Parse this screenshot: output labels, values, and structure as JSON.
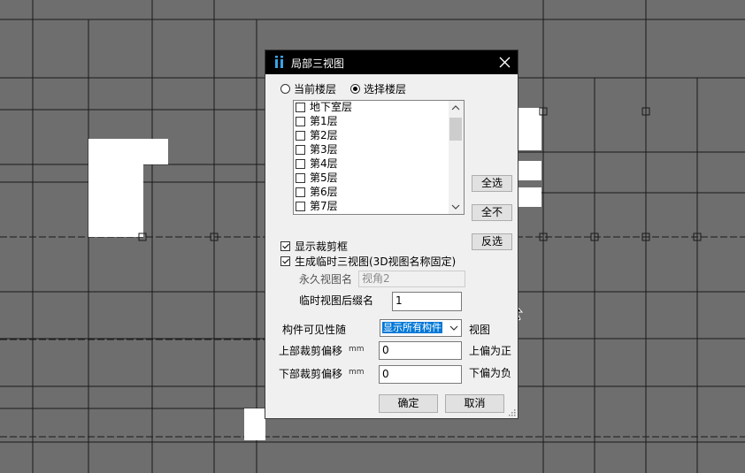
{
  "dialog": {
    "title": "局部三视图",
    "close_icon": "close-icon",
    "floor_mode": {
      "current_label": "当前楼层",
      "select_label": "选择楼层",
      "selected": "select"
    },
    "floors": [
      {
        "label": "地下室层",
        "checked": false
      },
      {
        "label": "第1层",
        "checked": false
      },
      {
        "label": "第2层",
        "checked": false
      },
      {
        "label": "第3层",
        "checked": false
      },
      {
        "label": "第4层",
        "checked": false
      },
      {
        "label": "第5层",
        "checked": false
      },
      {
        "label": "第6层",
        "checked": false
      },
      {
        "label": "第7层",
        "checked": false
      }
    ],
    "buttons": {
      "select_all": "全选",
      "select_none": "全不",
      "invert": "反选",
      "ok": "确定",
      "cancel": "取消"
    },
    "options": {
      "show_crop_frame": {
        "label": "显示裁剪框",
        "checked": true
      },
      "gen_temp_view": {
        "label": "生成临时三视图(3D视图名称固定)",
        "checked": true
      }
    },
    "permanent_view_name": {
      "label": "永久视图名",
      "value": "视角2"
    },
    "temp_view_suffix": {
      "label": "临时视图后缀名",
      "value": "1"
    },
    "visibility": {
      "label": "构件可见性随",
      "selected": "显示所有构件",
      "suffix": "视图"
    },
    "top_offset": {
      "label": "上部裁剪偏移",
      "unit": "mm",
      "value": "0",
      "note": "上偏为正"
    },
    "bottom_offset": {
      "label": "下部裁剪偏移",
      "unit": "mm",
      "value": "0",
      "note": "下偏为负"
    }
  },
  "colors": {
    "titlebar": "#000000",
    "dialog_bg": "#f0f0f0",
    "canvas_bg": "#6e6e6e",
    "selection": "#0078d7"
  }
}
